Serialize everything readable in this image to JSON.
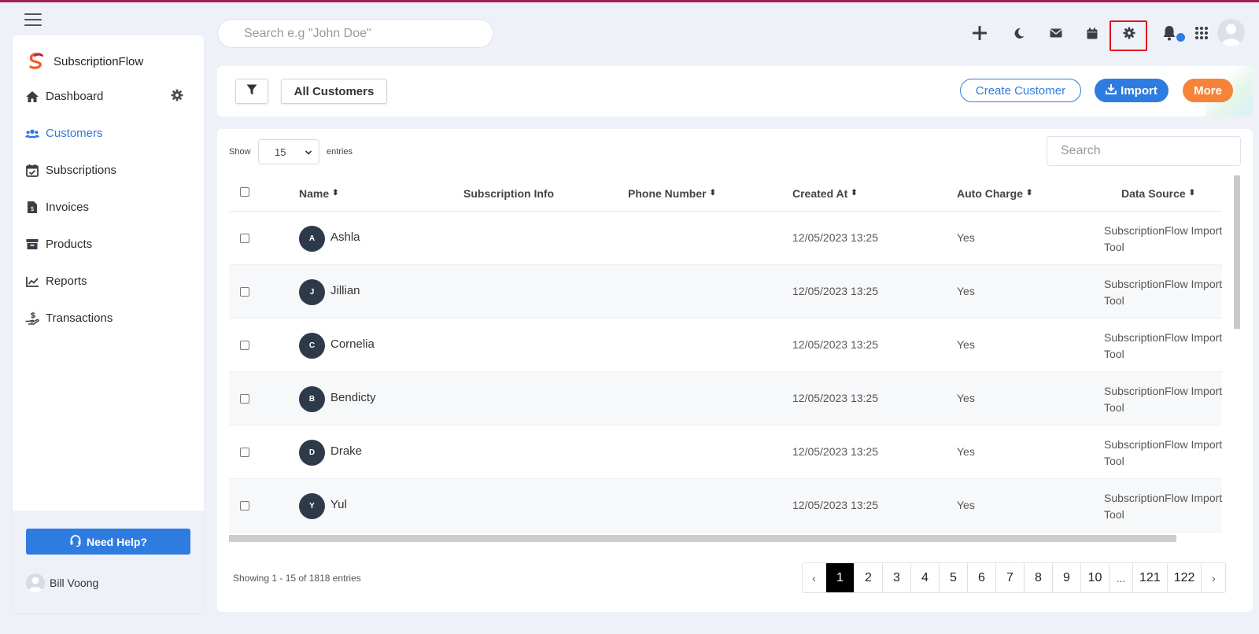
{
  "brand": {
    "name": "SubscriptionFlow"
  },
  "colors": {
    "accent": "#2f7ce0",
    "brand_dark": "#a0234f",
    "more": "#f5843a",
    "highlight": "#e0141d"
  },
  "top_search": {
    "placeholder": "Search e.g \"John Doe\""
  },
  "sidebar": {
    "items": [
      {
        "label": "Dashboard",
        "icon": "home-icon"
      },
      {
        "label": "Customers",
        "icon": "users-icon",
        "active": true
      },
      {
        "label": "Subscriptions",
        "icon": "calendar-check-icon"
      },
      {
        "label": "Invoices",
        "icon": "invoice-icon"
      },
      {
        "label": "Products",
        "icon": "archive-icon"
      },
      {
        "label": "Reports",
        "icon": "chart-line-icon"
      },
      {
        "label": "Transactions",
        "icon": "hand-dollar-icon"
      }
    ],
    "help_label": "Need Help?",
    "user_name": "Bill Voong"
  },
  "toolbar": {
    "all_customers": "All Customers",
    "create_customer": "Create Customer",
    "import": "Import",
    "more": "More"
  },
  "table_controls": {
    "show_label": "Show",
    "entries_value": "15",
    "entries_label": "entries",
    "search_placeholder": "Search"
  },
  "table": {
    "columns": [
      "Name",
      "Subscription Info",
      "Phone Number",
      "Created At",
      "Auto Charge",
      "Data Source"
    ],
    "rows": [
      {
        "initial": "A",
        "name": "Ashla",
        "subscription_info": "",
        "phone": "",
        "created_at": "12/05/2023 13:25",
        "auto_charge": "Yes",
        "data_source": "SubscriptionFlow Import Tool"
      },
      {
        "initial": "J",
        "name": "Jillian",
        "subscription_info": "",
        "phone": "",
        "created_at": "12/05/2023 13:25",
        "auto_charge": "Yes",
        "data_source": "SubscriptionFlow Import Tool"
      },
      {
        "initial": "C",
        "name": "Cornelia",
        "subscription_info": "",
        "phone": "",
        "created_at": "12/05/2023 13:25",
        "auto_charge": "Yes",
        "data_source": "SubscriptionFlow Import Tool"
      },
      {
        "initial": "B",
        "name": "Bendicty",
        "subscription_info": "",
        "phone": "",
        "created_at": "12/05/2023 13:25",
        "auto_charge": "Yes",
        "data_source": "SubscriptionFlow Import Tool"
      },
      {
        "initial": "D",
        "name": "Drake",
        "subscription_info": "",
        "phone": "",
        "created_at": "12/05/2023 13:25",
        "auto_charge": "Yes",
        "data_source": "SubscriptionFlow Import Tool"
      },
      {
        "initial": "Y",
        "name": "Yul",
        "subscription_info": "",
        "phone": "",
        "created_at": "12/05/2023 13:25",
        "auto_charge": "Yes",
        "data_source": "SubscriptionFlow Import Tool"
      }
    ]
  },
  "footer": {
    "showing": "Showing 1 - 15 of 1818 entries"
  },
  "pagination": {
    "prev": "‹",
    "pages": [
      "1",
      "2",
      "3",
      "4",
      "5",
      "6",
      "7",
      "8",
      "9",
      "10",
      "...",
      "121",
      "122"
    ],
    "active": "1",
    "next": "›"
  }
}
